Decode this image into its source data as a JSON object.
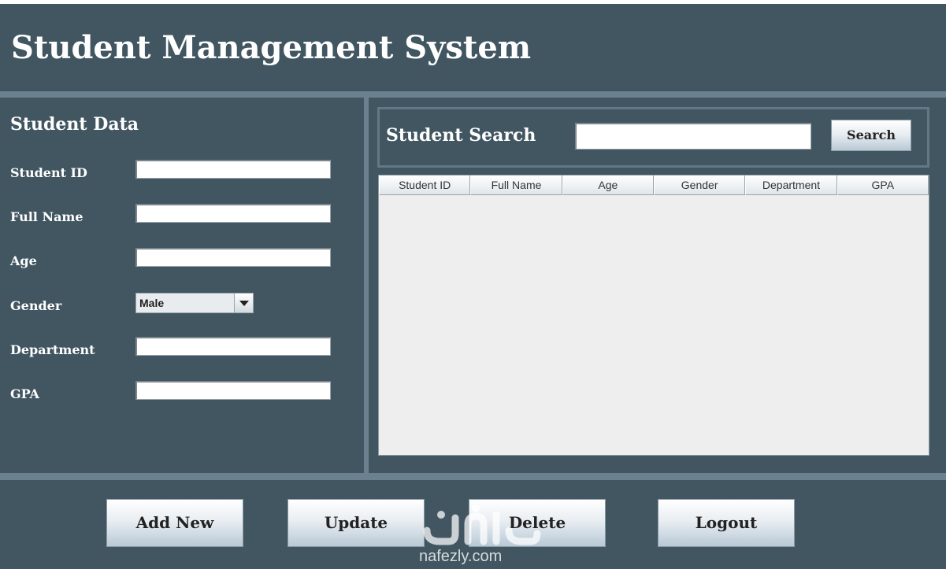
{
  "app": {
    "title": "Student Management System"
  },
  "student_form": {
    "title": "Student Data",
    "fields": [
      {
        "label": "Student ID",
        "value": ""
      },
      {
        "label": "Full Name",
        "value": ""
      },
      {
        "label": "Age",
        "value": ""
      },
      {
        "label": "Gender",
        "value": "Male"
      },
      {
        "label": "Department",
        "value": ""
      },
      {
        "label": "GPA",
        "value": ""
      }
    ]
  },
  "search": {
    "title": "Student Search",
    "query": "",
    "button_label": "Search"
  },
  "table": {
    "columns": [
      "Student ID",
      "Full Name",
      "Age",
      "Gender",
      "Department",
      "GPA"
    ],
    "rows": []
  },
  "actions": {
    "add_new": "Add New",
    "update": "Update",
    "delete": "Delete",
    "logout": "Logout"
  },
  "watermark": {
    "text": "nafezly.com"
  },
  "colors": {
    "panel_bg": "#415661",
    "separator": "#6b8190",
    "table_bg": "#eeeeee"
  },
  "icons": {
    "gender_dropdown": "chevron-down-icon"
  }
}
